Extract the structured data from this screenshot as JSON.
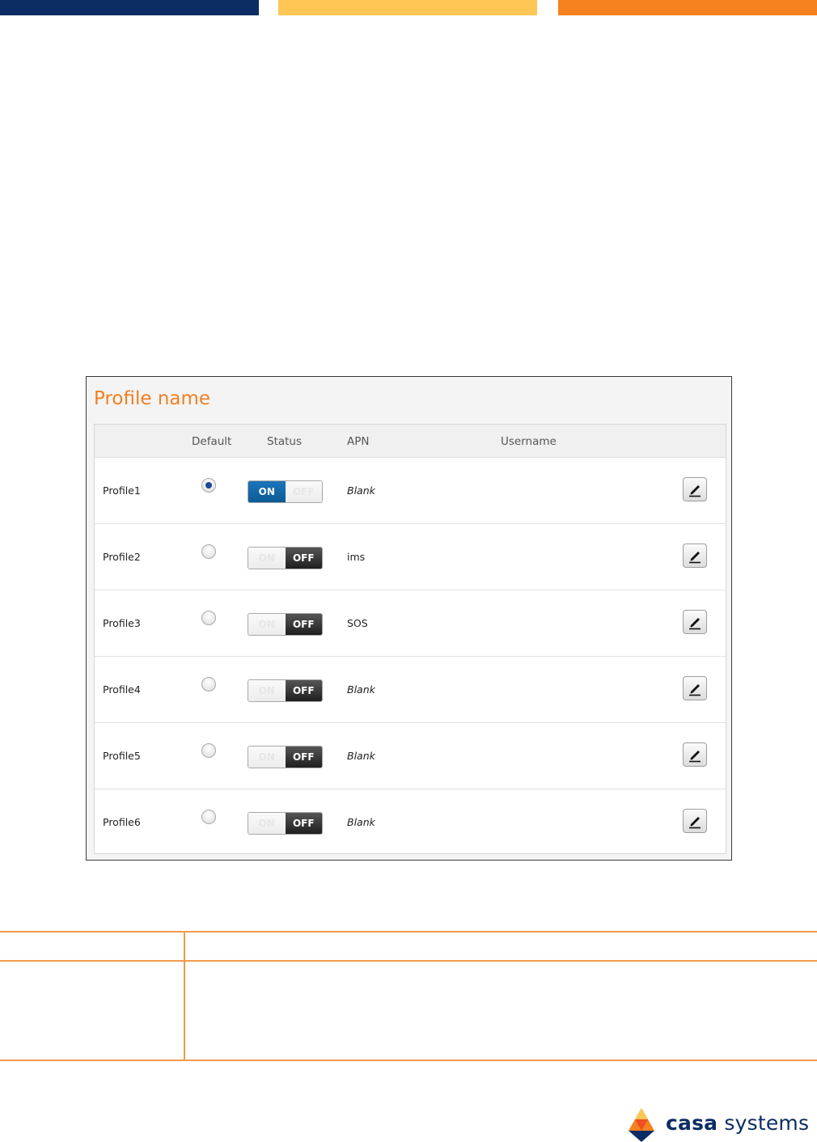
{
  "panel": {
    "title": "Profile name",
    "columns": {
      "default": "Default",
      "status": "Status",
      "apn": "APN",
      "username": "Username"
    },
    "toggle_labels": {
      "on": "ON",
      "off": "OFF"
    },
    "rows": [
      {
        "name": "Profile1",
        "default": true,
        "status": "ON",
        "apn": "Blank",
        "apn_italic": true
      },
      {
        "name": "Profile2",
        "default": false,
        "status": "OFF",
        "apn": "ims",
        "apn_italic": false
      },
      {
        "name": "Profile3",
        "default": false,
        "status": "OFF",
        "apn": "SOS",
        "apn_italic": false
      },
      {
        "name": "Profile4",
        "default": false,
        "status": "OFF",
        "apn": "Blank",
        "apn_italic": true
      },
      {
        "name": "Profile5",
        "default": false,
        "status": "OFF",
        "apn": "Blank",
        "apn_italic": true
      },
      {
        "name": "Profile6",
        "default": false,
        "status": "OFF",
        "apn": "Blank",
        "apn_italic": true
      }
    ]
  },
  "logo": {
    "word1": "casa",
    "word2": "systems"
  },
  "colors": {
    "navy": "#0c2d63",
    "yellow": "#fec655",
    "orange": "#f5821f",
    "toggle_on": "#1a76bb",
    "radio_selected": "#1a4a9a"
  },
  "icons": {
    "edit": "pencil-icon",
    "logo": "casa-triangle-logo"
  }
}
